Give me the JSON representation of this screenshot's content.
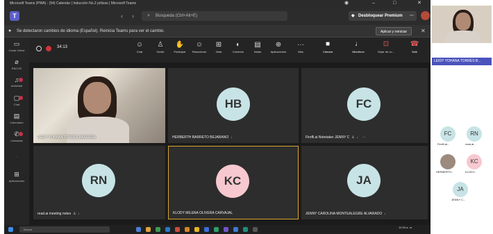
{
  "window": {
    "title": "Microsoft Teams (PWA) - (54) Calendar | Inducción No.2 pólizas | Microsoft Teams"
  },
  "header": {
    "search_placeholder": "Búsqueda (Ctrl+Alt+E)",
    "premium_label": "Desbloquear Premium"
  },
  "banner": {
    "text": "Se detectaron cambios de idioma (Español). Reinicia Teams para ver el cambio.",
    "apply_label": "Aplicar y reiniciar"
  },
  "rail": {
    "items": [
      {
        "label": "Canal Virtual",
        "icon": "camera-icon"
      },
      {
        "label": "ENCOS",
        "icon": "link-icon"
      },
      {
        "label": "Actividad",
        "icon": "bell-icon"
      },
      {
        "label": "Chat",
        "icon": "chat-icon"
      },
      {
        "label": "Calendario",
        "icon": "calendar-icon"
      },
      {
        "label": "Llamadas",
        "icon": "phone-icon"
      },
      {
        "label": "...",
        "icon": "more-icon"
      },
      {
        "label": "Aplicaciones",
        "icon": "apps-icon"
      }
    ]
  },
  "call": {
    "timer": "34:13",
    "controls": [
      "Chat",
      "Gente",
      "Participar",
      "Reaccionar",
      "Vista",
      "Contexto",
      "Notas",
      "Aplicaciones",
      "Más"
    ],
    "camera_label": "Cámara",
    "mic_label": "Micrófono",
    "share_label": "Dejar de co...",
    "leave_label": "Salir"
  },
  "tiles": [
    {
      "name": "LEIDY YOHANA TORRES BARRERA",
      "initials": "",
      "video": true
    },
    {
      "name": "HERBERTH BARRETO BEJARANO",
      "initials": "HB",
      "color": "#c7e3e5"
    },
    {
      "name": "Firefli.ai Notetaker JENNY C",
      "initials": "FC",
      "color": "#c7e3e5"
    },
    {
      "name": "read.ai meeting notes",
      "initials": "RN",
      "color": "#c7e3e5"
    },
    {
      "name": "KLODY MILENA OLIVERA CARVAJAL",
      "initials": "KC",
      "color": "#f7c8cf",
      "hand": "1"
    },
    {
      "name": "JENNY CAROLINA MONTEALEGRE ALVARADO",
      "initials": "JA",
      "color": "#c7e3e5"
    }
  ],
  "sidepanel": {
    "self_name": "LEIDY YOHANA TORRES B...",
    "participants": [
      {
        "initials": "FC",
        "label": "Firefli.ai...",
        "color": "#c7e3e5"
      },
      {
        "initials": "RN",
        "label": "read.ai...",
        "color": "#c7e3e5"
      },
      {
        "initials": "",
        "label": "HERBERTH...",
        "photo": true
      },
      {
        "initials": "KC",
        "label": "KLODY...",
        "color": "#f7c8cf"
      },
      {
        "initials": "JA",
        "label": "JENNY C...",
        "color": "#c7e3e5"
      }
    ]
  },
  "taskbar": {
    "search": "Buscar",
    "clock": "10:33 a. m."
  },
  "colors": {
    "teams_purple": "#5b5fc7",
    "hand_yellow": "#f5b700",
    "leave_red": "#d13438",
    "name_chip": "#4b53bc"
  }
}
